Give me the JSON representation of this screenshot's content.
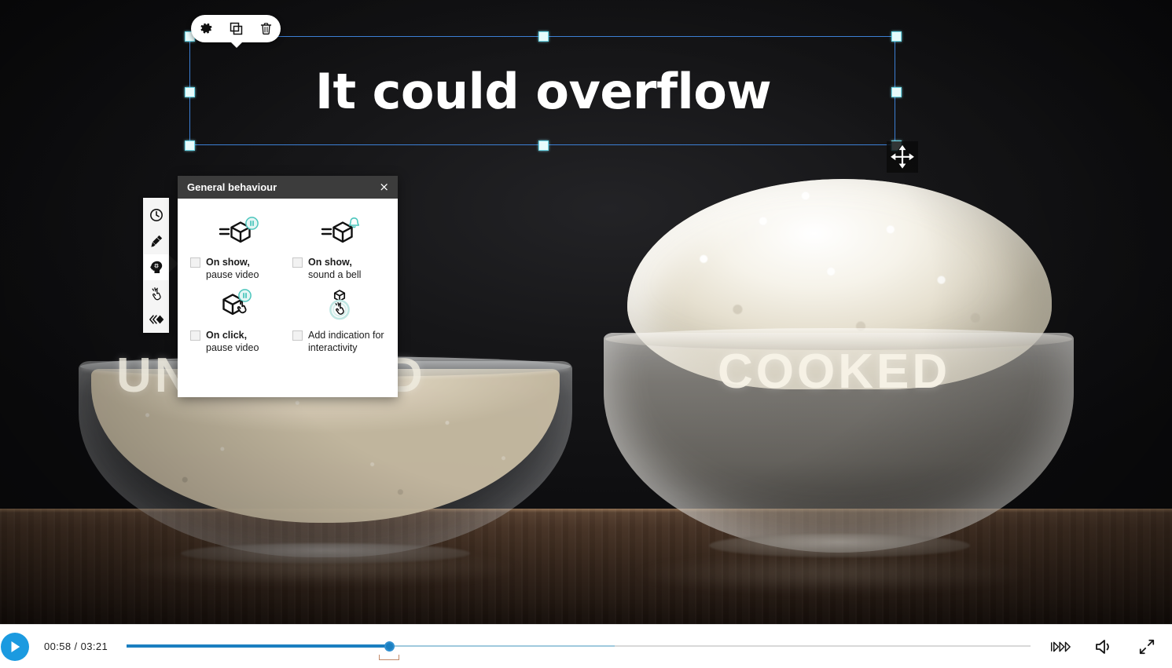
{
  "object_toolbar": {
    "buttons": [
      {
        "name": "settings",
        "icon": "gear-icon",
        "label": "Settings"
      },
      {
        "name": "duplicate",
        "icon": "duplicate-icon",
        "label": "Duplicate"
      },
      {
        "name": "delete",
        "icon": "trash-icon",
        "label": "Delete"
      }
    ]
  },
  "canvas": {
    "selected_text": "It could overflow",
    "cursor": "move-cursor"
  },
  "video": {
    "labels": {
      "left": "UNCOOKED",
      "right": "COOKED"
    }
  },
  "tool_strip": {
    "items": [
      {
        "name": "timing",
        "icon": "clock-icon",
        "label": "Timing",
        "active": false
      },
      {
        "name": "style",
        "icon": "paintbrush-icon",
        "label": "Style",
        "active": false
      },
      {
        "name": "general-behaviour",
        "icon": "brain-gear-icon",
        "label": "General behaviour",
        "active": true
      },
      {
        "name": "interactivity",
        "icon": "click-hand-icon",
        "label": "Interactivity",
        "active": false
      },
      {
        "name": "layers",
        "icon": "layers-arrows-icon",
        "label": "Layers",
        "active": false
      }
    ]
  },
  "behaviour_panel": {
    "title": "General behaviour",
    "close_label": "×",
    "options": [
      {
        "id": "on-show-pause-video",
        "icon": "cube-pause-icon",
        "label_bold": "On show,",
        "label_rest": "pause video",
        "checked": false
      },
      {
        "id": "on-show-sound-a-bell",
        "icon": "cube-bell-icon",
        "label_bold": "On show,",
        "label_rest": "sound a bell",
        "checked": false
      },
      {
        "id": "on-click-pause-video",
        "icon": "cube-click-pause-icon",
        "label_bold": "On click,",
        "label_rest": "pause video",
        "checked": false
      },
      {
        "id": "add-indication-for-interactivity",
        "icon": "cube-hand-glow-icon",
        "label_bold": "",
        "label_rest": "Add indication for interactivity",
        "checked": false
      }
    ]
  },
  "playback": {
    "play_label": "Play",
    "current_time": "00:58",
    "total_time": "03:21",
    "time_display": "00:58 / 03:21",
    "progress_percent": 29,
    "buffer_percent": 54,
    "chapter_marker_percent": 29,
    "controls": [
      {
        "name": "playback-speed",
        "icon": "playback-speed-icon",
        "label": "Playback speed"
      },
      {
        "name": "volume",
        "icon": "volume-icon",
        "label": "Volume"
      },
      {
        "name": "fullscreen",
        "icon": "fullscreen-icon",
        "label": "Fullscreen"
      }
    ]
  },
  "colors": {
    "accent_blue": "#1b9ae0",
    "progress_blue": "#1b7fc0",
    "selection_blue": "#3c7fd4",
    "teal_badge": "#4cc6bd",
    "panel_header": "#3c3c3c"
  }
}
